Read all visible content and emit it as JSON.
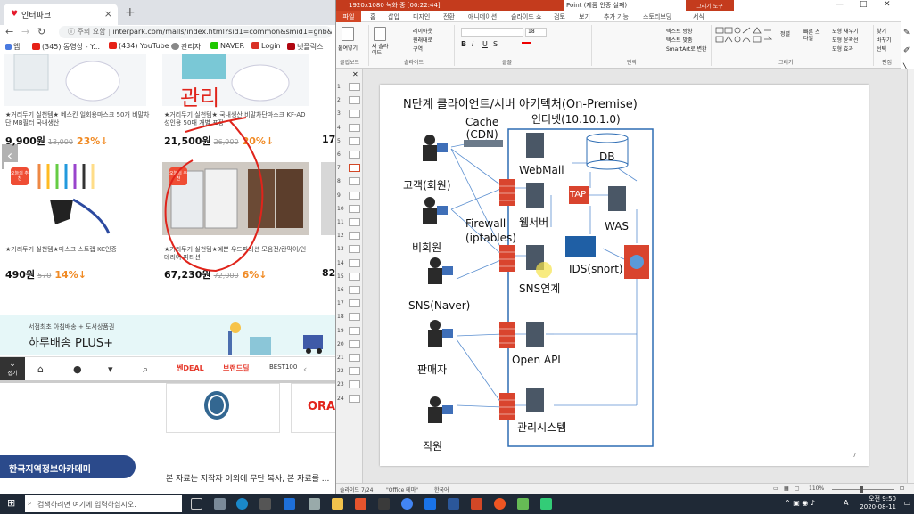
{
  "browser": {
    "tab_title": "인터파크",
    "address": {
      "security": "주의 요함",
      "url": "interpark.com/malls/index.html?sid1=common&smid1=gnb&smid2=lo..."
    },
    "bookmarks": [
      "앱",
      "(345) 동영상 - Y...",
      "(434) YouTube",
      "관리자",
      "NAVER",
      "Login",
      "넷플릭스"
    ],
    "products_top": [
      {
        "name": "★거리두기 실천템★ 베스킨 일회용마스크 50개 비말차단 MB필터 국내생산",
        "price": "9,900원",
        "orig": "13,000",
        "discount": "23%↓"
      },
      {
        "name": "★거리두기 실천템★ 국내생산 비말차단마스크 KF-AD 성인용 50매 개별 포장",
        "price": "21,500원",
        "orig": "26,900",
        "discount": "20%↓"
      },
      {
        "price": "17"
      }
    ],
    "products_bottom": [
      {
        "badge": "오늘의 추천",
        "name": "★거리두기 실천템★마스크 스트랩 KC인증",
        "price": "490원",
        "orig": "570",
        "discount": "14%↓"
      },
      {
        "badge": "오늘의 추천",
        "name": "★거리두기 실천템★예쁜 우드파티션 모음전/칸막이/인테리어 파티션",
        "price": "67,230원",
        "orig": "72,000",
        "discount": "6%↓"
      },
      {
        "price": "82"
      }
    ],
    "promo": {
      "small": "서점최초 아침배송 + 도서상품권",
      "big": "하루배송 PLUS+"
    },
    "bottom_nav": {
      "menu": "접기",
      "deal": "쎈DEAL",
      "brand": "브랜드딜",
      "best": "BEST100"
    },
    "annotation": "관리"
  },
  "background_page": {
    "academy": "한국지역정보아카데미",
    "notice": "본 자료는 저작자 이외에 무단 복사, 본 자료를 ..."
  },
  "ppt": {
    "recording": "1920x1080    녹화 중 [00:22:44]",
    "app_title": "Point (제품 인증 실패)",
    "drawing_tools": "그리기 도구",
    "ribbon_tabs": [
      "파일",
      "홈",
      "삽입",
      "디자인",
      "전환",
      "애니메이션",
      "슬라이드 쇼",
      "검토",
      "보기",
      "추가 기능",
      "스토리보딩",
      "서식"
    ],
    "ribbon_groups": [
      "클립보드",
      "슬라이드",
      "글꼴",
      "단락",
      "그리기",
      "편집"
    ],
    "ribbon_labels": {
      "paste": "붙여넣기",
      "new_slide": "새 슬라이드",
      "layout": "레이아웃",
      "reset": "원래대로",
      "section": "구역",
      "arrange": "정렬",
      "quick_styles": "빠른 스타일",
      "font_size": "18",
      "direction": "텍스트 방향",
      "align": "텍스트 맞춤",
      "smartart": "SmartArt로 변환",
      "find": "찾기",
      "replace": "바꾸기",
      "select": "선택",
      "fill": "도형 채우기",
      "outline": "도형 윤곽선",
      "effects": "도형 효과"
    },
    "slide_numbers": [
      "1",
      "2",
      "3",
      "4",
      "5",
      "6",
      "7",
      "8",
      "9",
      "10",
      "11",
      "12",
      "13",
      "14",
      "15",
      "16",
      "17",
      "18",
      "19",
      "20",
      "21",
      "22",
      "23",
      "24"
    ],
    "slide": {
      "title": "N단계 클라이언트/서버 아키텍처(On-Premise)",
      "internet": "인터넷(10.10.1.0)",
      "cache": "Cache\n(CDN)",
      "db": "DB",
      "webmail": "WebMail",
      "tap": "TAP",
      "was": "WAS",
      "webserver": "웹서버",
      "firewall": "Firewall\n(iptables)",
      "ids": "IDS(snort)",
      "sns_link": "SNS연계",
      "customer": "고객(회원)",
      "nonmember": "비회원",
      "sns": "SNS(Naver)",
      "seller": "판매자",
      "openapi": "Open API",
      "employee": "직원",
      "admin": "관리시스템",
      "page_no": "7"
    },
    "status": {
      "slide": "슬라이드 7/24",
      "theme": "\"Office 테마\"",
      "lang": "한국어",
      "zoom": "110%"
    }
  },
  "taskbar": {
    "search": "검색하려면 여기에 입력하십시오.",
    "time": "오전 9:50",
    "date": "2020-08-11",
    "ime": "A"
  }
}
